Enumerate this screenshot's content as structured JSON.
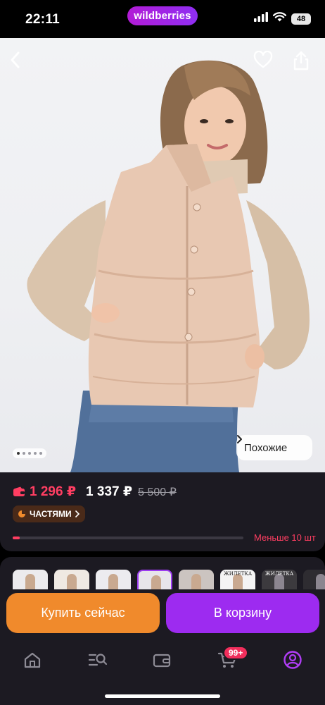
{
  "status_bar": {
    "time": "22:11",
    "brand": "wildberries",
    "battery": "48",
    "icons": [
      "cellular-signal-icon",
      "wifi-icon",
      "battery-icon"
    ]
  },
  "header": {
    "back_icon": "chevron-left-icon",
    "favorite_icon": "heart-icon",
    "share_icon": "share-icon"
  },
  "gallery": {
    "page_count": 5,
    "active_page": 1,
    "similar_label": "Похожие",
    "similar_icon": "chevron-right-icon"
  },
  "pricing": {
    "wallet_price": "1 296 ₽",
    "wallet_icon": "wallet-icon",
    "price": "1 337 ₽",
    "old_price": "5 500 ₽",
    "installments_label": "ЧАСТЯМИ",
    "installments_icon": "pie-chart-icon",
    "stock_label": "Меньше 10 шт",
    "stock_level": 0.03
  },
  "variants": {
    "thumb_texts": [
      "",
      "",
      "",
      "",
      "",
      "ЖИЛЕТКА",
      "ЖИЛЕТКА",
      ""
    ],
    "selected_index": 3
  },
  "actions": {
    "buy_now": "Купить сейчас",
    "add_to_cart": "В корзину"
  },
  "tab_bar": {
    "items": [
      "home-icon",
      "catalog-search-icon",
      "wallet-icon",
      "cart-icon",
      "profile-icon"
    ],
    "active": "profile-icon",
    "cart_badge": "99+"
  },
  "colors": {
    "accent_purple": "#9d2bf0",
    "accent_orange": "#f08a2c",
    "price_red": "#ff3e62",
    "surface": "#1c1a22"
  }
}
